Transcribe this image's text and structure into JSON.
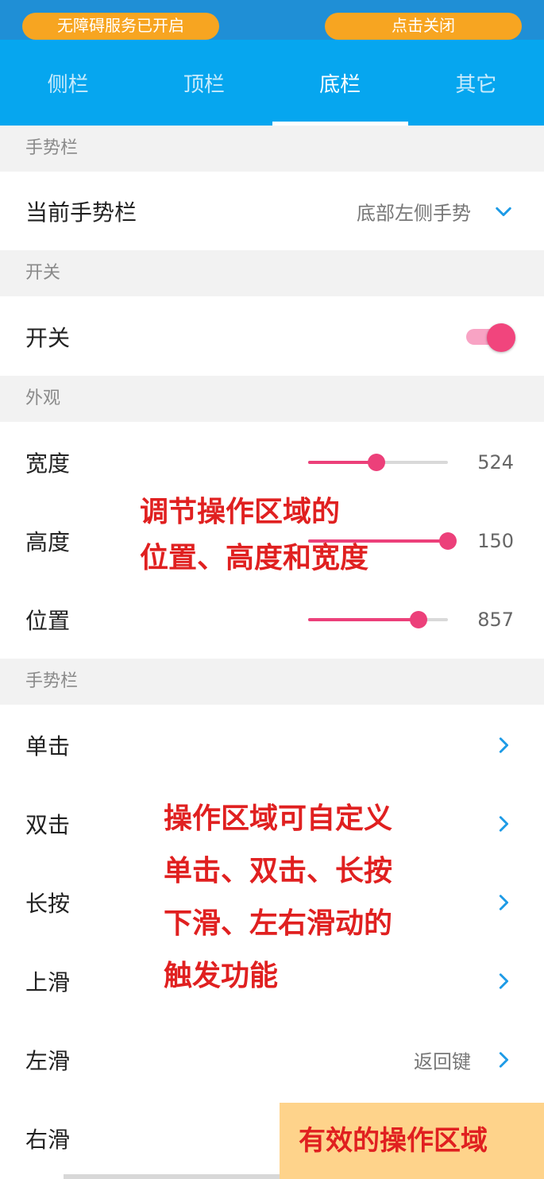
{
  "banners": {
    "left": "无障碍服务已开启",
    "right": "点击关闭"
  },
  "tabs": [
    {
      "label": "侧栏",
      "active": false
    },
    {
      "label": "顶栏",
      "active": false
    },
    {
      "label": "底栏",
      "active": true
    },
    {
      "label": "其它",
      "active": false
    }
  ],
  "sections": {
    "gesture_bar": "手势栏",
    "switch": "开关",
    "appearance": "外观",
    "gestures": "手势栏"
  },
  "current_gesture_bar": {
    "label": "当前手势栏",
    "value": "底部左侧手势"
  },
  "switch_row": {
    "label": "开关",
    "on": true
  },
  "appearance": {
    "width": {
      "label": "宽度",
      "value": "524",
      "fraction": 0.49
    },
    "height": {
      "label": "高度",
      "value": "150",
      "fraction": 1.0
    },
    "position": {
      "label": "位置",
      "value": "857",
      "fraction": 0.79
    }
  },
  "gestures": {
    "tap": {
      "label": "单击",
      "value": ""
    },
    "double_tap": {
      "label": "双击",
      "value": ""
    },
    "long_press": {
      "label": "长按",
      "value": ""
    },
    "swipe_up": {
      "label": "上滑",
      "value": ""
    },
    "swipe_left": {
      "label": "左滑",
      "value": "返回键"
    },
    "swipe_right": {
      "label": "右滑",
      "value": ""
    }
  },
  "annotations": {
    "appearance_note": [
      "调节操作区域的",
      "位置、高度和宽度"
    ],
    "gesture_note": [
      "操作区域可自定义",
      "单击、双击、长按",
      "下滑、左右滑动的",
      "触发功能"
    ],
    "effective_area": "有效的操作区域"
  },
  "colors": {
    "tab_bar": "#06a6ef",
    "banner": "#f7a521",
    "accent_pink": "#ec407a",
    "annotation_red": "#e02020",
    "chevron_blue": "#1e9be6",
    "effective_area_bg": "#fed38b"
  }
}
